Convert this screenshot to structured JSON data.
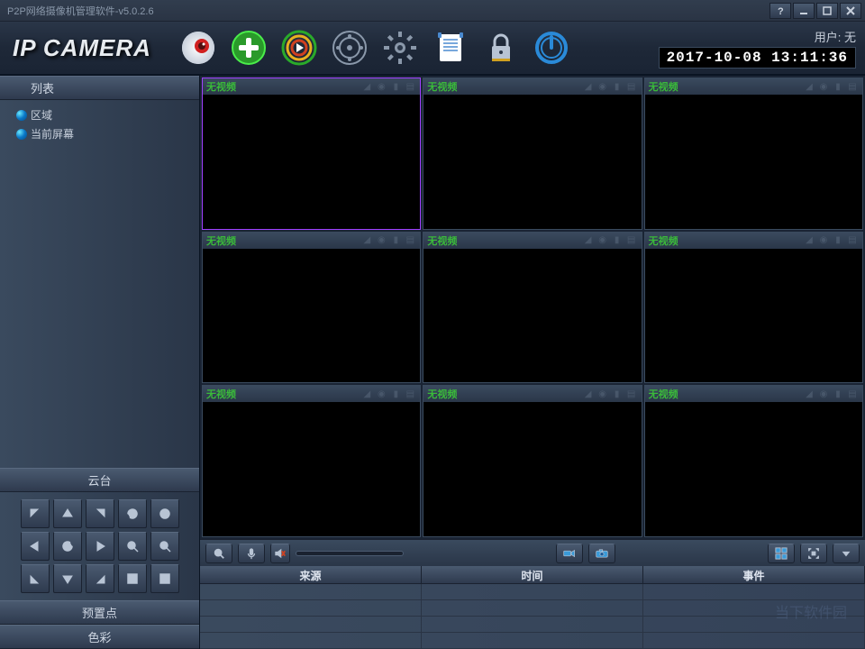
{
  "titlebar": {
    "title": "P2P网络摄像机管理软件-v5.0.2.6"
  },
  "header": {
    "logo": "IP CAMERA",
    "user_label": "用户:",
    "user_value": "无",
    "datetime": "2017-10-08 13:11:36"
  },
  "sidebar": {
    "list_header": "列表",
    "tree": {
      "region": "区域",
      "current_screen": "当前屏幕"
    },
    "ptz_header": "云台",
    "preset_header": "预置点",
    "color_header": "色彩"
  },
  "video": {
    "cells": [
      {
        "label": "无视频",
        "active": true
      },
      {
        "label": "无视频",
        "active": false
      },
      {
        "label": "无视频",
        "active": false
      },
      {
        "label": "无视频",
        "active": false
      },
      {
        "label": "无视频",
        "active": false
      },
      {
        "label": "无视频",
        "active": false
      },
      {
        "label": "无视频",
        "active": false
      },
      {
        "label": "无视频",
        "active": false
      },
      {
        "label": "无视频",
        "active": false
      }
    ]
  },
  "events": {
    "col_source": "来源",
    "col_time": "时间",
    "col_event": "事件"
  },
  "watermark": "当下软件园"
}
